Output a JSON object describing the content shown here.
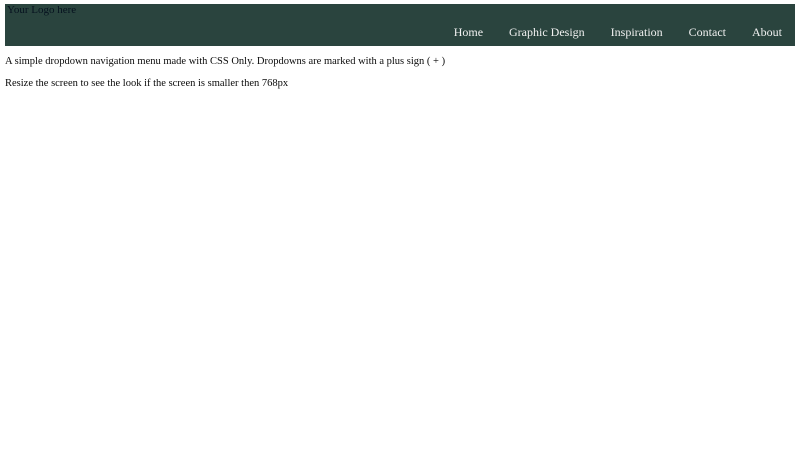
{
  "header": {
    "logo_text": "Your Logo here",
    "background_color": "#2a443e",
    "nav_text_color": "#f1f1f1",
    "nav_items": [
      {
        "label": "Home"
      },
      {
        "label": "Graphic Design"
      },
      {
        "label": "Inspiration"
      },
      {
        "label": "Contact"
      },
      {
        "label": "About"
      }
    ]
  },
  "content": {
    "paragraph1": "A simple dropdown navigation menu made with CSS Only. Dropdowns are marked with a plus sign ( + )",
    "paragraph2": "Resize the screen to see the look if the screen is smaller then 768px"
  }
}
